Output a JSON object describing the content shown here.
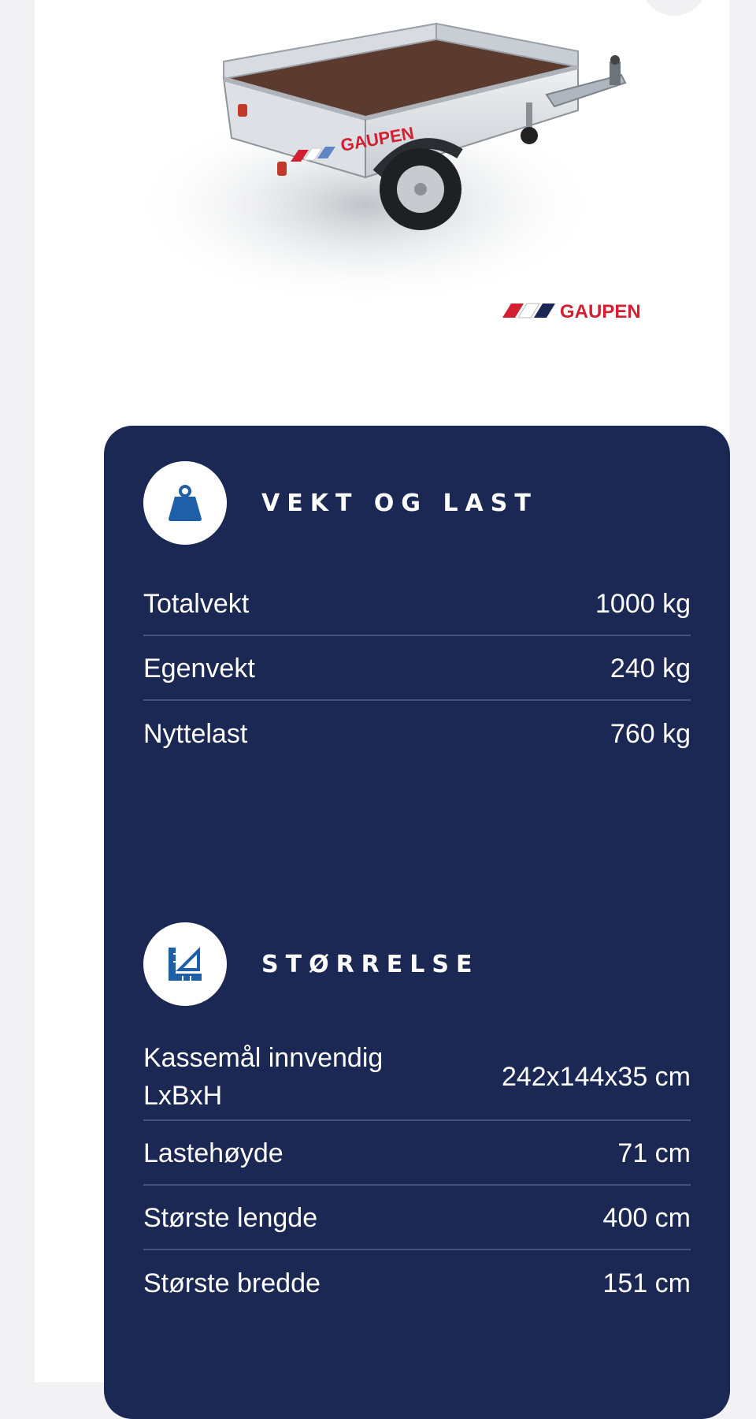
{
  "product": {
    "image_alt": "Gaupen tilhenger",
    "brand_side": "GAUPEN",
    "brand_logo": "GAUPEN",
    "brand_colors": [
      "#d22030",
      "#5e86c4",
      "#1b2853"
    ]
  },
  "sections": [
    {
      "title": "VEKT OG LAST",
      "icon": "weight-icon",
      "rows": [
        {
          "label": "Totalvekt",
          "value": "1000 kg"
        },
        {
          "label": "Egenvekt",
          "value": "240 kg"
        },
        {
          "label": "Nyttelast",
          "value": "760 kg"
        }
      ]
    },
    {
      "title": "STØRRELSE",
      "icon": "ruler-icon",
      "rows": [
        {
          "label": "Kassemål innvendig LxBxH",
          "value": "242x144x35 cm"
        },
        {
          "label": "Lastehøyde",
          "value": "71 cm"
        },
        {
          "label": "Største lengde",
          "value": "400 cm"
        },
        {
          "label": "Største bredde",
          "value": "151 cm"
        }
      ]
    }
  ],
  "colors": {
    "panel": "#1b2853",
    "icon_blue": "#1f5fa8",
    "divider": "#46537a",
    "background": "#f2f2f4"
  }
}
